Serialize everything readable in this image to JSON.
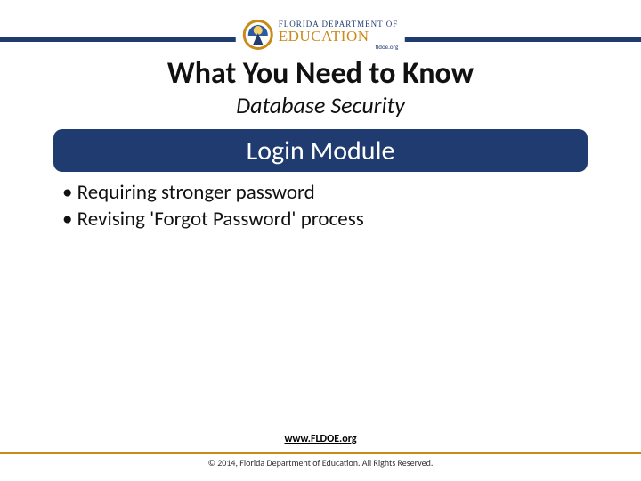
{
  "logo": {
    "line1": "FLORIDA DEPARTMENT OF",
    "line2": "EDUCATION",
    "line3": "fldoe.org"
  },
  "title": "What You Need to Know",
  "subtitle": "Database Security",
  "section_heading": "Login Module",
  "bullets": [
    "Requiring stronger password",
    "Revising 'Forgot Password' process"
  ],
  "footer": {
    "link_text": "www.FLDOE.org",
    "copyright": "© 2014, Florida Department of Education. All Rights Reserved."
  }
}
